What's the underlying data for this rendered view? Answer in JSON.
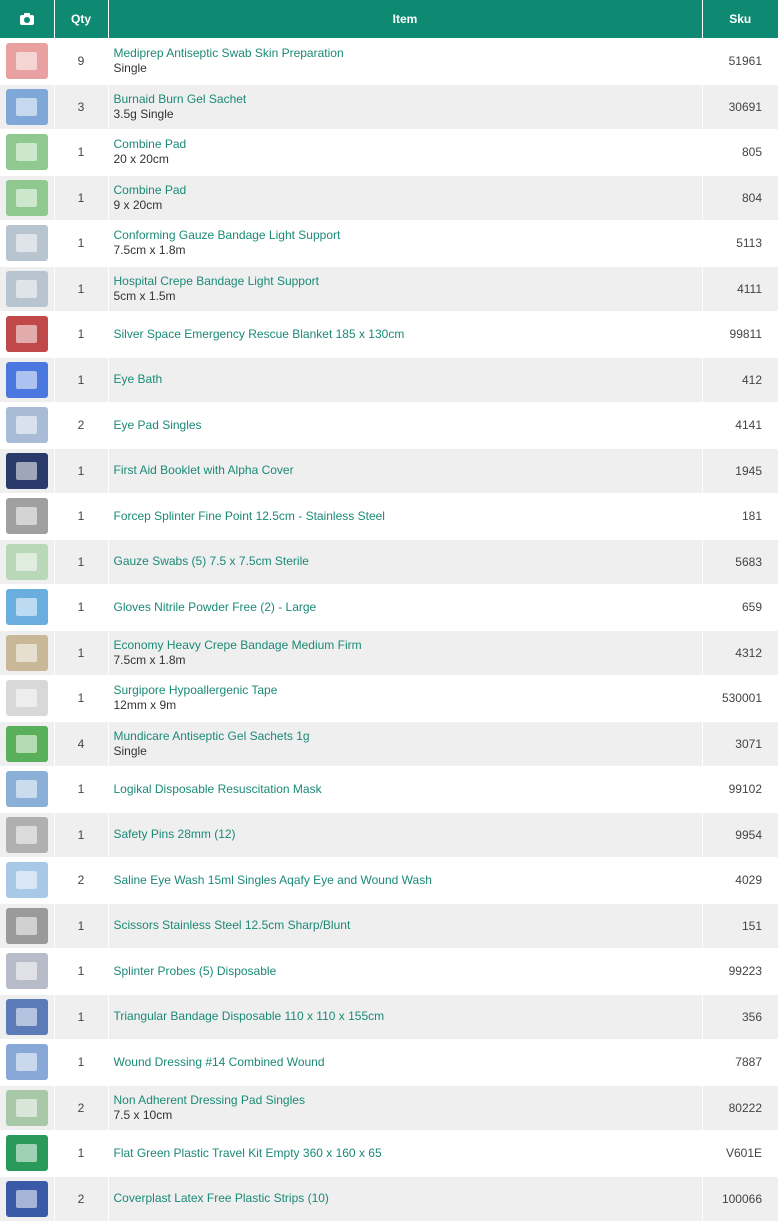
{
  "table": {
    "headers": {
      "image_icon": "camera-icon",
      "qty": "Qty",
      "item": "Item",
      "sku": "Sku"
    },
    "rows": [
      {
        "qty": "9",
        "name": "Mediprep Antiseptic Swab Skin Preparation",
        "variant": "Single",
        "sku": "51961",
        "thumb_color": "#e8a0a0"
      },
      {
        "qty": "3",
        "name": "Burnaid Burn Gel Sachet",
        "variant": "3.5g Single",
        "sku": "30691",
        "thumb_color": "#7fa8d8"
      },
      {
        "qty": "1",
        "name": "Combine Pad",
        "variant": "20 x 20cm",
        "sku": "805",
        "thumb_color": "#8fc98f"
      },
      {
        "qty": "1",
        "name": "Combine Pad",
        "variant": "9 x 20cm",
        "sku": "804",
        "thumb_color": "#8fc98f"
      },
      {
        "qty": "1",
        "name": "Conforming Gauze Bandage Light Support",
        "variant": "7.5cm x 1.8m",
        "sku": "5113",
        "thumb_color": "#b8c4d0"
      },
      {
        "qty": "1",
        "name": "Hospital Crepe Bandage Light Support",
        "variant": "5cm x 1.5m",
        "sku": "4111",
        "thumb_color": "#b8c4d0"
      },
      {
        "qty": "1",
        "name": "Silver Space Emergency Rescue Blanket 185 x 130cm",
        "variant": "",
        "sku": "99811",
        "thumb_color": "#c04848"
      },
      {
        "qty": "1",
        "name": "Eye Bath",
        "variant": "",
        "sku": "412",
        "thumb_color": "#4a78e0"
      },
      {
        "qty": "2",
        "name": "Eye Pad Singles",
        "variant": "",
        "sku": "4141",
        "thumb_color": "#a8bcd8"
      },
      {
        "qty": "1",
        "name": "First Aid Booklet with Alpha Cover",
        "variant": "",
        "sku": "1945",
        "thumb_color": "#2a3a6a"
      },
      {
        "qty": "1",
        "name": "Forcep Splinter Fine Point 12.5cm - Stainless Steel",
        "variant": "",
        "sku": "181",
        "thumb_color": "#a0a0a0"
      },
      {
        "qty": "1",
        "name": "Gauze Swabs (5) 7.5 x 7.5cm Sterile",
        "variant": "",
        "sku": "5683",
        "thumb_color": "#b8d8b8"
      },
      {
        "qty": "1",
        "name": "Gloves Nitrile Powder Free (2) - Large",
        "variant": "",
        "sku": "659",
        "thumb_color": "#6aaee0"
      },
      {
        "qty": "1",
        "name": "Economy Heavy Crepe Bandage Medium Firm",
        "variant": "7.5cm x 1.8m",
        "sku": "4312",
        "thumb_color": "#c8b898"
      },
      {
        "qty": "1",
        "name": "Surgipore Hypoallergenic Tape",
        "variant": "12mm x 9m",
        "sku": "530001",
        "thumb_color": "#d8d8d8"
      },
      {
        "qty": "4",
        "name": "Mundicare Antiseptic Gel Sachets 1g",
        "variant": "Single",
        "sku": "3071",
        "thumb_color": "#5ab05a"
      },
      {
        "qty": "1",
        "name": "Logikal Disposable Resuscitation Mask",
        "variant": "",
        "sku": "99102",
        "thumb_color": "#8ab0d8"
      },
      {
        "qty": "1",
        "name": "Safety Pins 28mm (12)",
        "variant": "",
        "sku": "9954",
        "thumb_color": "#b0b0b0"
      },
      {
        "qty": "2",
        "name": "Saline Eye Wash 15ml Singles Aqafy Eye and Wound Wash",
        "variant": "",
        "sku": "4029",
        "thumb_color": "#a8c8e8"
      },
      {
        "qty": "1",
        "name": "Scissors Stainless Steel 12.5cm Sharp/Blunt",
        "variant": "",
        "sku": "151",
        "thumb_color": "#9a9a9a"
      },
      {
        "qty": "1",
        "name": "Splinter Probes (5) Disposable",
        "variant": "",
        "sku": "99223",
        "thumb_color": "#b8bcc8"
      },
      {
        "qty": "1",
        "name": "Triangular Bandage Disposable 110 x 110 x 155cm",
        "variant": "",
        "sku": "356",
        "thumb_color": "#5a7ab8"
      },
      {
        "qty": "1",
        "name": "Wound Dressing #14 Combined Wound",
        "variant": "",
        "sku": "7887",
        "thumb_color": "#88a8d8"
      },
      {
        "qty": "2",
        "name": "Non Adherent Dressing Pad Singles",
        "variant": "7.5 x 10cm",
        "sku": "80222",
        "thumb_color": "#a8c8a8"
      },
      {
        "qty": "1",
        "name": "Flat Green Plastic Travel Kit Empty 360 x 160 x 65",
        "variant": "",
        "sku": "V601E",
        "thumb_color": "#2a9a5a"
      },
      {
        "qty": "2",
        "name": "Coverplast Latex Free Plastic Strips (10)",
        "variant": "",
        "sku": "100066",
        "thumb_color": "#3a5aa8"
      }
    ]
  }
}
